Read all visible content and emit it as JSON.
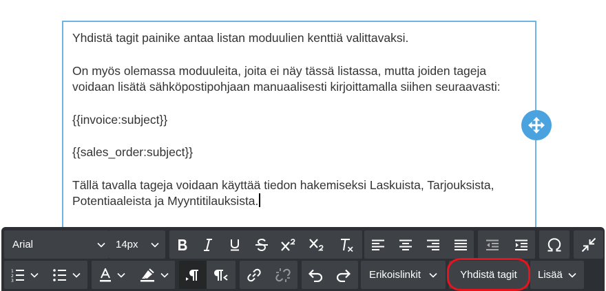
{
  "editor": {
    "paragraphs": [
      "Yhdistä tagit painike antaa listan moduulien kenttiä valittavaksi.",
      "On myös olemassa moduuleita, joita ei näy tässä listassa, mutta joiden tageja voidaan lisätä sähköpostipohjaan manuaalisesti kirjoittamalla siihen seuraavasti:",
      "{{invoice:subject}}",
      "{{sales_order:subject}}",
      "Tällä tavalla tageja voidaan käyttää tiedon hakemiseksi Laskuista, Tarjouksista, Potentiaaleista ja Myyntitilauksista."
    ]
  },
  "toolbar": {
    "font_family": "Arial",
    "font_size": "14px",
    "special_links_label": "Erikoislinkit",
    "merge_tags_label": "Yhdistä tagit",
    "more_label": "Lisää"
  },
  "colors": {
    "accent": "#4aa3df",
    "toolbar_bg": "#2c2f33",
    "button_bg": "#3e4246",
    "highlight": "#e8131c"
  },
  "icons": [
    "move-icon",
    "chevron-down-icon",
    "bold-icon",
    "italic-icon",
    "underline-icon",
    "strikethrough-icon",
    "superscript-icon",
    "subscript-icon",
    "clear-format-icon",
    "align-left-icon",
    "align-center-icon",
    "align-right-icon",
    "align-justify-icon",
    "outdent-icon",
    "indent-icon",
    "omega-icon",
    "collapse-icon",
    "ordered-list-icon",
    "unordered-list-icon",
    "text-color-icon",
    "highlight-color-icon",
    "ltr-icon",
    "rtl-icon",
    "link-icon",
    "unlink-icon",
    "undo-icon",
    "redo-icon"
  ]
}
